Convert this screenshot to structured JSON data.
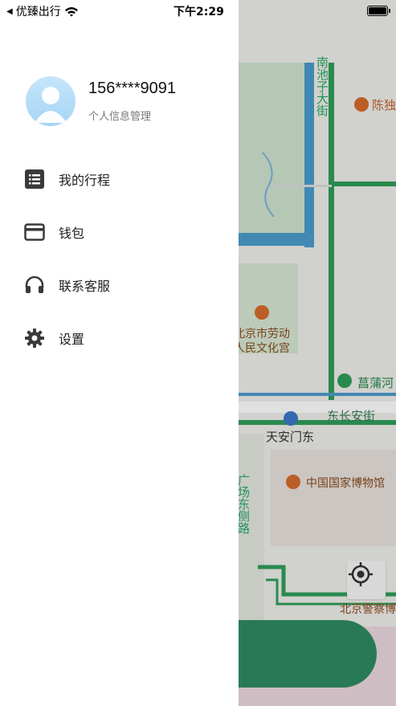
{
  "status_bar": {
    "carrier": "优臻出行",
    "time": "下午2:29"
  },
  "profile": {
    "phone": "156****9091",
    "subtitle": "个人信息管理"
  },
  "menu": [
    {
      "label": "我的行程",
      "icon": "list-icon"
    },
    {
      "label": "钱包",
      "icon": "wallet-icon"
    },
    {
      "label": "联系客服",
      "icon": "headset-icon"
    },
    {
      "label": "设置",
      "icon": "gear-icon"
    }
  ],
  "map": {
    "labels": {
      "street_north": "南池子大街",
      "chen": "陈独",
      "laodong": "北京市劳动",
      "wenhua": "人民文化宫",
      "changpu": "菖蒲河",
      "changan": "东长安街",
      "tiananmen_east": "天安门东",
      "museum": "中国国家博物馆",
      "guangchang": "广场东侧路",
      "police": "北京警察博"
    }
  },
  "colors": {
    "accent_green": "#2e8b63",
    "map_water": "#4a9ccc",
    "road_green": "#2f9e5b"
  }
}
